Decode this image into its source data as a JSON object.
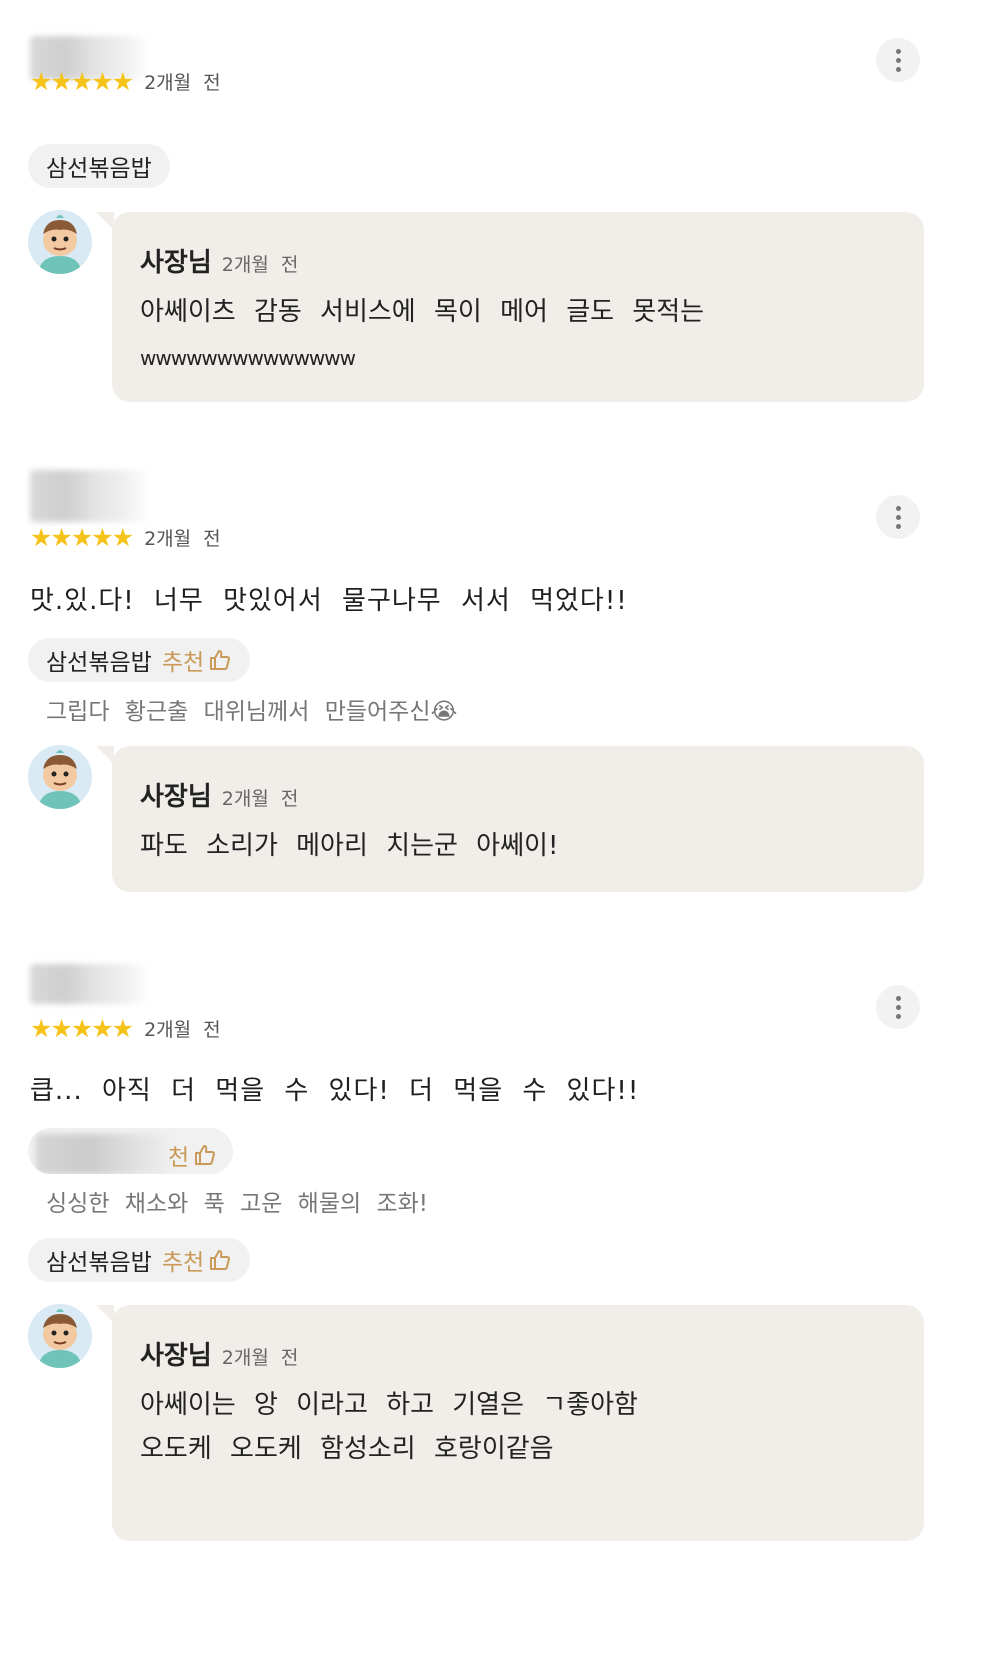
{
  "reviews": [
    {
      "stars": "★★★★★",
      "time": "2개월 전",
      "text": "",
      "menus": [
        {
          "name": "삼선볶음밥",
          "recommend": "",
          "comment": ""
        }
      ],
      "owner": {
        "name": "사장님",
        "time": "2개월 전",
        "lines": [
          "아쎄이츠 감동 서비스에 목이 메어 글도 못적는",
          "wwwwwwwwwwwwww"
        ]
      }
    },
    {
      "stars": "★★★★★",
      "time": "2개월 전",
      "text": "맛.있.다! 너무 맛있어서 물구나무 서서 먹었다!!",
      "menus": [
        {
          "name": "삼선볶음밥",
          "recommend": "추천",
          "comment": "그립다 황근출 대위님께서 만들어주신😭"
        }
      ],
      "owner": {
        "name": "사장님",
        "time": "2개월 전",
        "lines": [
          "파도 소리가 메아리 치는군 아쎄이!"
        ]
      }
    },
    {
      "stars": "★★★★★",
      "time": "2개월 전",
      "text": "큽... 아직 더 먹을 수 있다! 더 먹을 수 있다!!",
      "menus": [
        {
          "name": "",
          "recommend": "천",
          "comment": "싱싱한 채소와 푹 고운 해물의 조화!"
        },
        {
          "name": "삼선볶음밥",
          "recommend": "추천",
          "comment": ""
        }
      ],
      "owner": {
        "name": "사장님",
        "time": "2개월 전",
        "lines": [
          "아쎄이는 앙 이라고 하고 기열은 ㄱ좋아함",
          "오도케 오도케 함성소리 호랑이같음"
        ]
      }
    }
  ],
  "icons": {
    "more": "more-vertical-icon",
    "thumb": "thumbs-up-icon",
    "star": "star-icon",
    "avatar": "owner-avatar"
  },
  "colors": {
    "star": "#f5c319",
    "recommend": "#c99a57",
    "owner_bubble": "#f1eeea",
    "chip": "#f1f1f1"
  }
}
